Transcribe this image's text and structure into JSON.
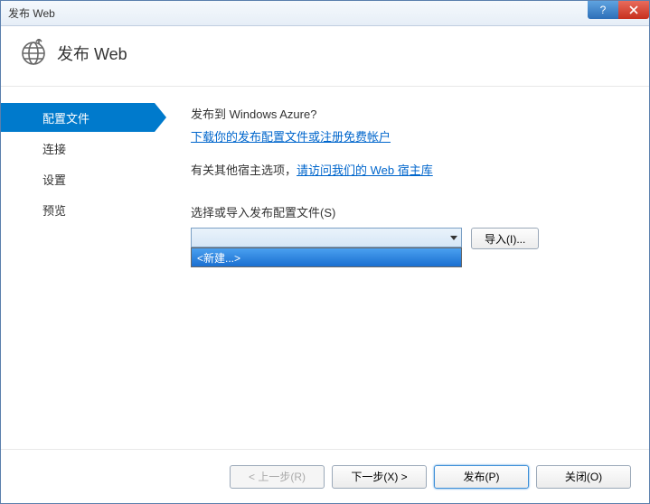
{
  "window": {
    "title": "发布 Web"
  },
  "header": {
    "title": "发布 Web"
  },
  "sidebar": {
    "items": [
      {
        "label": "配置文件",
        "active": true
      },
      {
        "label": "连接"
      },
      {
        "label": "设置"
      },
      {
        "label": "预览"
      }
    ]
  },
  "content": {
    "azure_question": "发布到 Windows Azure?",
    "download_link": "下载你的发布配置文件或注册免费帐户",
    "host_prefix": "有关其他宿主选项，",
    "host_link": "请访问我们的 Web 宿主库",
    "profile_label": "选择或导入发布配置文件(S)",
    "dropdown_selected": "",
    "dropdown_option_new": "<新建...>",
    "import_button": "导入(I)..."
  },
  "footer": {
    "prev": "< 上一步(R)",
    "next": "下一步(X) >",
    "publish": "发布(P)",
    "close": "关闭(O)"
  }
}
